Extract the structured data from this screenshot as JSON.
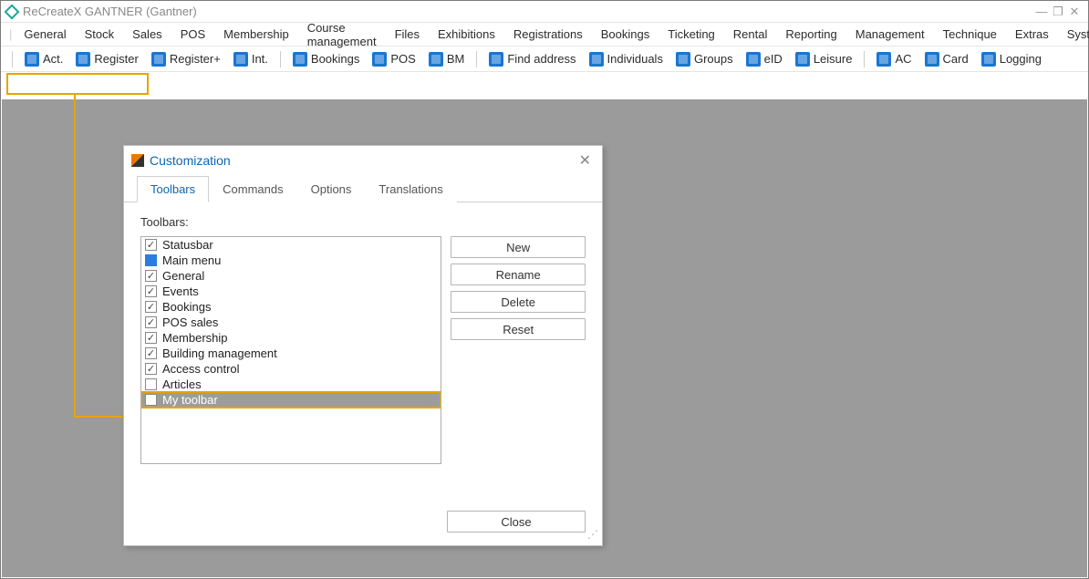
{
  "title": "ReCreateX GANTNER  (Gantner)",
  "menu": [
    "General",
    "Stock",
    "Sales",
    "POS",
    "Membership",
    "Course management",
    "Files",
    "Exhibitions",
    "Registrations",
    "Bookings",
    "Ticketing",
    "Rental",
    "Reporting",
    "Management",
    "Technique",
    "Extras",
    "System"
  ],
  "toolbar_groups": [
    [
      "Act.",
      "Register",
      "Register+",
      "Int."
    ],
    [
      "Bookings",
      "POS",
      "BM"
    ],
    [
      "Find address",
      "Individuals",
      "Groups",
      "eID",
      "Leisure"
    ],
    [
      "AC",
      "Card",
      "Logging"
    ]
  ],
  "dialog": {
    "title": "Customization",
    "tabs": [
      "Toolbars",
      "Commands",
      "Options",
      "Translations"
    ],
    "active_tab": 0,
    "list_label": "Toolbars:",
    "items": [
      {
        "label": "Statusbar",
        "checked": true,
        "blue": false
      },
      {
        "label": "Main menu",
        "checked": false,
        "blue": true
      },
      {
        "label": "General",
        "checked": true,
        "blue": false
      },
      {
        "label": "Events",
        "checked": true,
        "blue": false
      },
      {
        "label": "Bookings",
        "checked": true,
        "blue": false
      },
      {
        "label": "POS sales",
        "checked": true,
        "blue": false
      },
      {
        "label": "Membership",
        "checked": true,
        "blue": false
      },
      {
        "label": "Building management",
        "checked": true,
        "blue": false
      },
      {
        "label": "Access control",
        "checked": true,
        "blue": false
      },
      {
        "label": "Articles",
        "checked": false,
        "blue": false
      },
      {
        "label": "My toolbar",
        "checked": true,
        "blue": false,
        "selected": true
      }
    ],
    "buttons": {
      "new": "New",
      "rename": "Rename",
      "delete": "Delete",
      "reset": "Reset",
      "close": "Close"
    }
  }
}
